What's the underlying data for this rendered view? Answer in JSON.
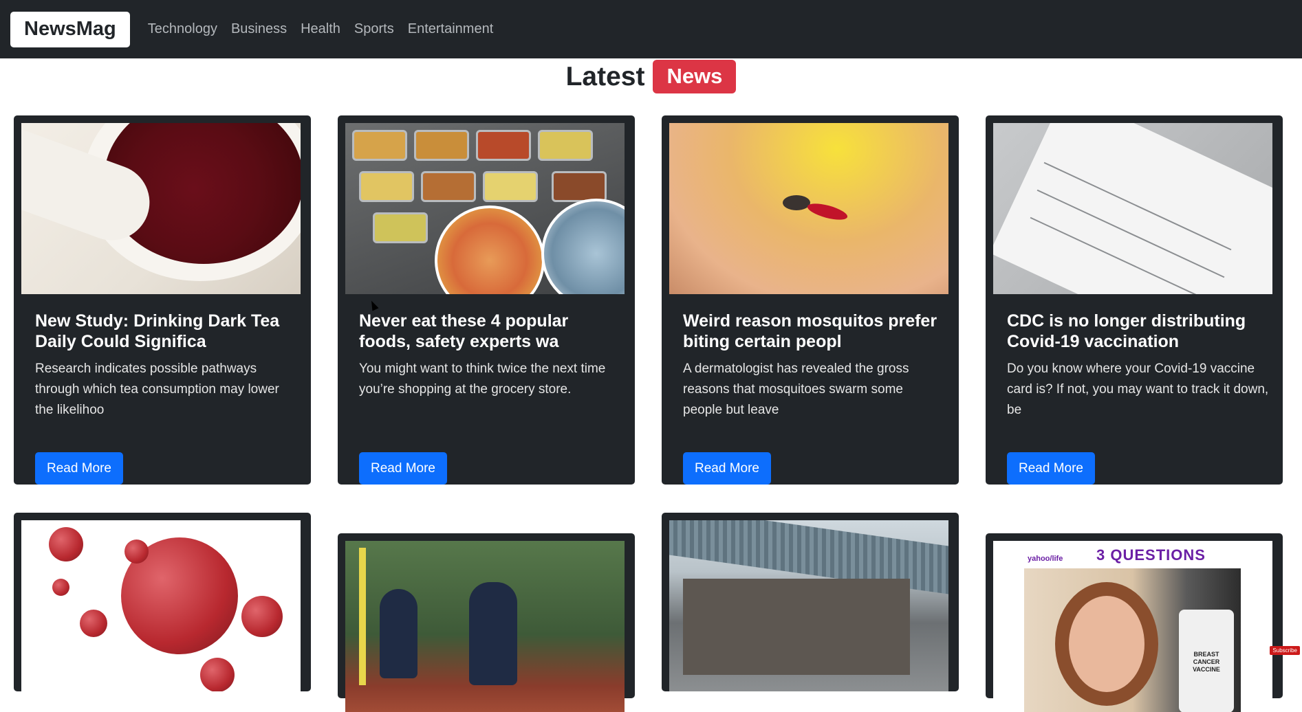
{
  "nav": {
    "brand": "NewsMag",
    "links": [
      "Technology",
      "Business",
      "Health",
      "Sports",
      "Entertainment"
    ]
  },
  "heading": {
    "latest": "Latest",
    "badge": "News"
  },
  "cards": [
    {
      "title": "New Study: Drinking Dark Tea Daily Could Significa",
      "text": "Research indicates possible pathways through which tea consumption may lower the likelihoo",
      "button": "Read More",
      "image": "tea-pour-image"
    },
    {
      "title": "Never eat these 4 popular foods, safety experts wa",
      "text": "You might want to think twice the next time you’re shopping at the grocery store.",
      "button": "Read More",
      "image": "buffet-food-image"
    },
    {
      "title": "Weird reason mosquitos prefer biting certain peopl",
      "text": "A dermatologist has revealed the gross reasons that mosquitoes swarm some people but leave",
      "button": "Read More",
      "image": "mosquito-image"
    },
    {
      "title": "CDC is no longer distributing Covid-19 vaccination",
      "text": "Do you know where your Covid-19 vaccine card is? If not, you may want to track it down, be",
      "button": "Read More",
      "image": "vaccination-card-image"
    }
  ],
  "row2": {
    "yahoo_logo": "yahoo/life",
    "yahoo_title": "3 QUESTIONS",
    "vial_text": "BREAST CANCER VACCINE"
  },
  "overlay": {
    "subscribe": "Subscribe"
  },
  "colors": {
    "navbar": "#212529",
    "card": "#212529",
    "badge": "#dc3545",
    "button": "#0d6efd"
  }
}
